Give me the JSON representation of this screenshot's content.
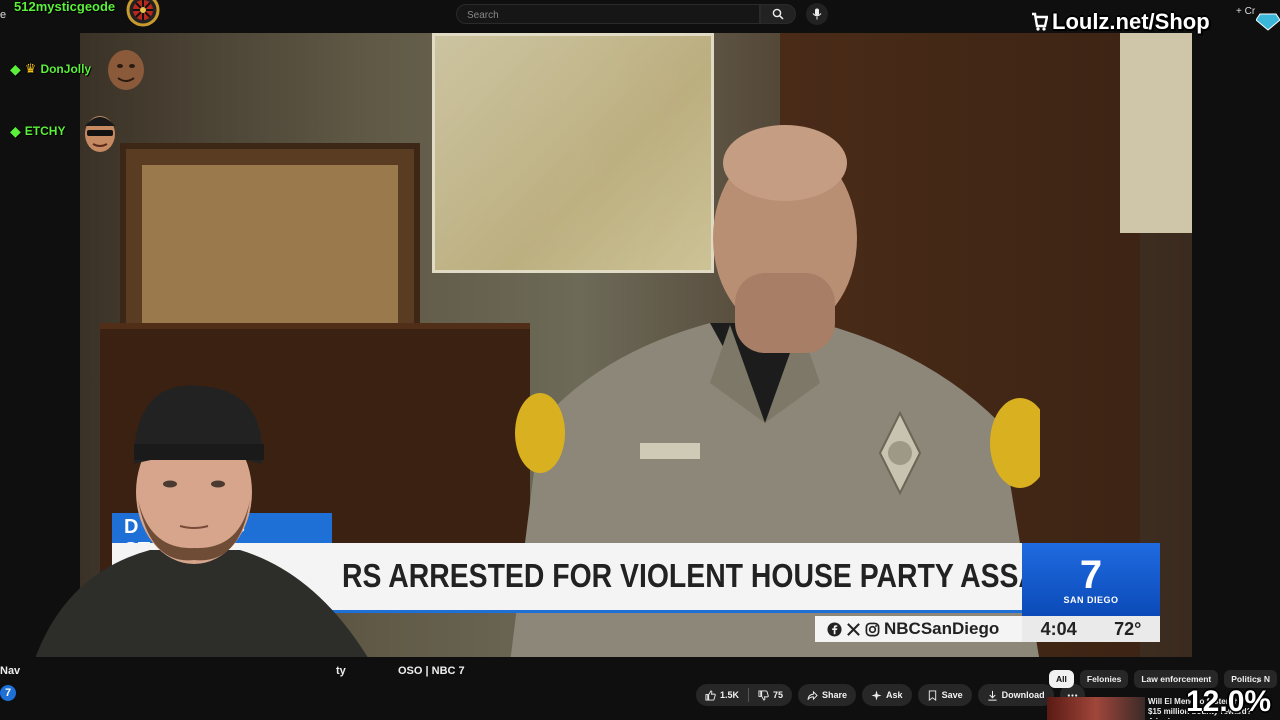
{
  "topbar": {
    "left_fragment": "e",
    "streamer": "512mysticgeode",
    "search_placeholder": "Search",
    "shop_text": "Loulz.net/Shop",
    "create_label": "+ Cr"
  },
  "chat": [
    {
      "name": "DonJolly",
      "badge": "crown"
    },
    {
      "name": "ETCHY",
      "badge": ""
    }
  ],
  "video": {
    "banner_label": "D               G STORY",
    "headline": "RS ARRESTED FOR VIOLENT HOUSE PARTY ASSAULT",
    "social_handle": "NBCSanDiego",
    "station_number": "7",
    "station_city": "SAN DIEGO",
    "time": "4:04",
    "temperature": "72°"
  },
  "bottom": {
    "title_left": "Nav",
    "title_mid": "ty",
    "title_right": "OSO | NBC 7",
    "channel_logo": "7",
    "likes": "1.5K",
    "dislikes": "75",
    "share": "Share",
    "ask": "Ask",
    "save": "Save",
    "download": "Download",
    "chips": [
      "All",
      "Felonies",
      "Law enforcement",
      "Politics N"
    ],
    "rec_title": "Will El Mencho foster the $15 million bounty reward? A look...",
    "overlay_percent": "12.0%"
  },
  "colors": {
    "accent_green": "#5bf03a",
    "nbc_blue": "#1e6fd6",
    "bar_bg": "#0f0f0f"
  }
}
